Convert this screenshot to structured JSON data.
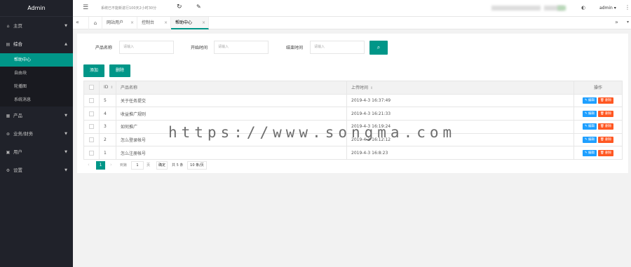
{
  "sidebar": {
    "title": "Admin",
    "menus": [
      {
        "label": "主页",
        "icon": "home-icon",
        "glyph": "⌂"
      },
      {
        "label": "综合",
        "icon": "list-icon",
        "glyph": "▤"
      },
      {
        "label": "产品",
        "icon": "product-icon",
        "glyph": "▦"
      },
      {
        "label": "业务/财务",
        "icon": "finance-icon",
        "glyph": "⊛"
      },
      {
        "label": "用户",
        "icon": "user-icon",
        "glyph": "▣"
      },
      {
        "label": "设置",
        "icon": "settings-icon",
        "glyph": "⚙"
      }
    ],
    "sub_items": [
      "帮助中心",
      "自由块",
      "轮播图",
      "系统消息"
    ]
  },
  "header": {
    "notice": "系统已不能新进行100天2小时30分",
    "user": "admin"
  },
  "tabs": [
    {
      "label": "网站用户"
    },
    {
      "label": "控制台"
    },
    {
      "label": "帮助中心"
    }
  ],
  "search": {
    "name_label": "产品名称",
    "name_placeholder": "请输入",
    "start_label": "开始时间",
    "start_placeholder": "请输入",
    "end_label": "结束时间",
    "end_placeholder": "请输入"
  },
  "buttons": {
    "add": "添加",
    "delete": "删除"
  },
  "table": {
    "headers": {
      "id": "ID",
      "name": "产品名称",
      "time": "上传时间",
      "action": "操作"
    },
    "rows": [
      {
        "id": "5",
        "name": "关于任务提交",
        "time": "2019-4-3 16:37:49"
      },
      {
        "id": "4",
        "name": "收益推广规则",
        "time": "2019-4-3 16:21:33"
      },
      {
        "id": "3",
        "name": "如何推广",
        "time": "2019-4-3 16:19:24"
      },
      {
        "id": "2",
        "name": "怎么登录帐号",
        "time": "2019-4-3 16:12:12"
      },
      {
        "id": "1",
        "name": "怎么注册帐号",
        "time": "2019-4-3 16:8:23"
      }
    ],
    "edit_label": "编辑",
    "delete_label": "删除"
  },
  "pager": {
    "current": "1",
    "to_label": "到第",
    "input_value": "1",
    "page_label": "页",
    "go_label": "确定",
    "total": "共 5 条",
    "size": "10 条/页"
  },
  "watermark": "https://www.songma.com",
  "colors": {
    "accent": "#009688",
    "sidebar": "#20222a",
    "edit": "#1e9fff",
    "danger": "#ff5722"
  }
}
